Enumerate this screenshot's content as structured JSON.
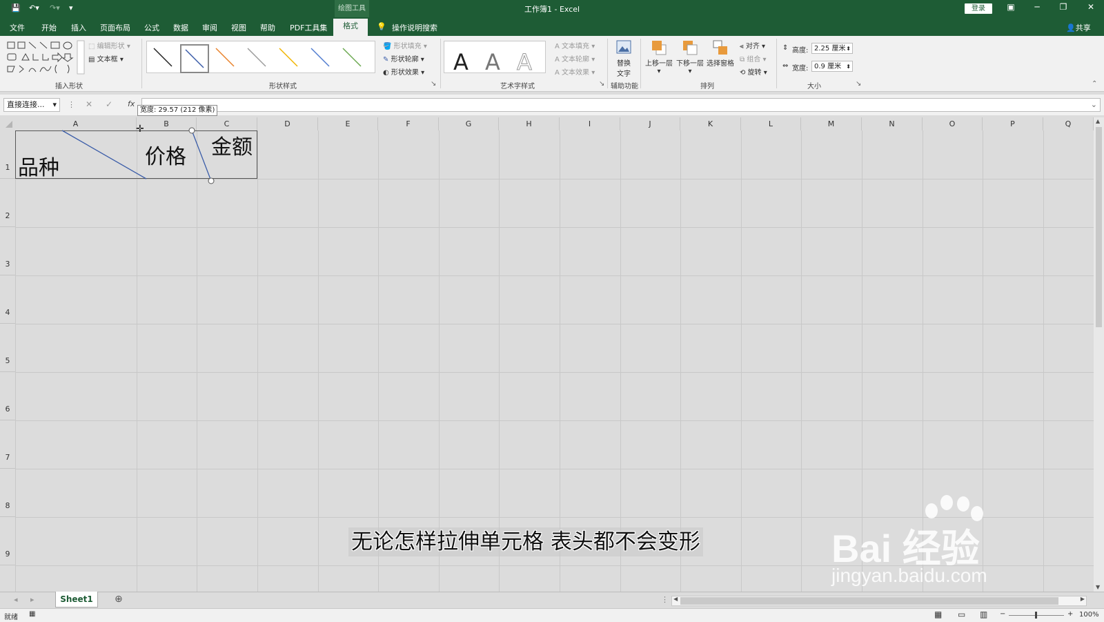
{
  "titlebar": {
    "context_group": "绘图工具",
    "title": "工作簿1  -  Excel",
    "login": "登录"
  },
  "tabs": {
    "items": [
      "文件",
      "开始",
      "插入",
      "页面布局",
      "公式",
      "数据",
      "审阅",
      "视图",
      "帮助",
      "PDF工具集"
    ],
    "active": "格式",
    "tell_me": "操作说明搜索",
    "share": "共享"
  },
  "ribbon": {
    "insert_shapes": {
      "label": "插入形状",
      "edit_shape": "编辑形状",
      "text_box": "文本框"
    },
    "shape_styles": {
      "label": "形状样式",
      "fill": "形状填充",
      "outline": "形状轮廓",
      "effects": "形状效果"
    },
    "wordart": {
      "label": "艺术字样式",
      "glyph": "A",
      "text_fill": "文本填充",
      "text_outline": "文本轮廓",
      "text_effects": "文本效果"
    },
    "accessibility": {
      "label": "辅助功能",
      "alt_text_1": "替换",
      "alt_text_2": "文字"
    },
    "arrange": {
      "label": "排列",
      "bring_forward": "上移一层",
      "send_backward": "下移一层",
      "selection_pane": "选择窗格",
      "align": "对齐",
      "group": "组合",
      "rotate": "旋转"
    },
    "size": {
      "label": "大小",
      "height_label": "高度:",
      "height_value": "2.25 厘米",
      "width_label": "宽度:",
      "width_value": "0.9 厘米"
    }
  },
  "formula_bar": {
    "name_box": "直接连接...",
    "fx": "fx",
    "value": ""
  },
  "tooltip": "宽度: 29.57 (212 像素)",
  "grid": {
    "columns": [
      "A",
      "B",
      "C",
      "D",
      "E",
      "F",
      "G",
      "H",
      "I",
      "J",
      "K",
      "L",
      "M",
      "N",
      "O",
      "P",
      "Q"
    ],
    "rows": [
      "1",
      "2",
      "3",
      "4",
      "5",
      "6",
      "7",
      "8",
      "9"
    ],
    "cells": {
      "A1": "品种",
      "B1": "价格",
      "C1": "金额"
    }
  },
  "subtitle": "无论怎样拉伸单元格 表头都不会变形",
  "watermark": {
    "brand": "Bai  经验",
    "url": "jingyan.baidu.com"
  },
  "sheets": {
    "active": "Sheet1"
  },
  "status": {
    "ready": "就绪",
    "zoom": "100%"
  },
  "colors": {
    "excel_green": "#1e5c35",
    "grid_line": "#c8c8c8",
    "diagonal_line": "#3a5ca8"
  }
}
